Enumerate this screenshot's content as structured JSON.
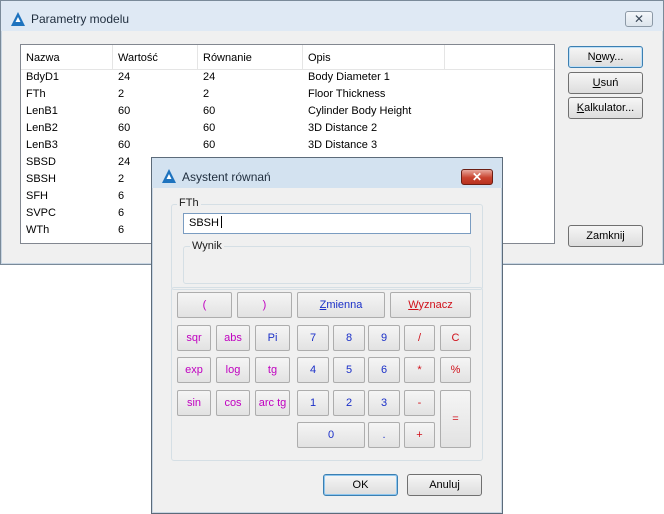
{
  "main_window": {
    "title": "Parametry modelu",
    "close_label": "✕",
    "columns": [
      "Nazwa",
      "Wartość",
      "Równanie",
      "Opis"
    ],
    "rows": [
      {
        "name": "BdyD1",
        "value": "24",
        "equation": "24",
        "description": "Body Diameter 1"
      },
      {
        "name": "FTh",
        "value": "2",
        "equation": "2",
        "description": "Floor Thickness"
      },
      {
        "name": "LenB1",
        "value": "60",
        "equation": "60",
        "description": "Cylinder Body Height"
      },
      {
        "name": "LenB2",
        "value": "60",
        "equation": "60",
        "description": "3D Distance 2"
      },
      {
        "name": "LenB3",
        "value": "60",
        "equation": "60",
        "description": "3D Distance 3"
      },
      {
        "name": "SBSD",
        "value": "24",
        "equation": "",
        "description": ""
      },
      {
        "name": "SBSH",
        "value": "2",
        "equation": "",
        "description": ""
      },
      {
        "name": "SFH",
        "value": "6",
        "equation": "",
        "description": ""
      },
      {
        "name": "SVPC",
        "value": "6",
        "equation": "",
        "description": ""
      },
      {
        "name": "WTh",
        "value": "6",
        "equation": "",
        "description": ""
      }
    ],
    "buttons": {
      "new": {
        "pre": "N",
        "ul": "o",
        "post": "wy..."
      },
      "delete": {
        "pre": "",
        "ul": "U",
        "post": "suń"
      },
      "calculator": {
        "pre": "",
        "ul": "K",
        "post": "alkulator..."
      },
      "close": {
        "pre": "Zamknij",
        "ul": "",
        "post": ""
      }
    }
  },
  "dialog": {
    "title": "Asystent równań",
    "close_label": "✕",
    "group_label": "FTh",
    "input_value": "SBSH",
    "result_label": "Wynik",
    "row1": {
      "open_paren": "(",
      "close_paren": ")",
      "variable": {
        "pre": "",
        "ul": "Z",
        "post": "mienna"
      },
      "calculate": {
        "pre": "",
        "ul": "W",
        "post": "yznacz"
      }
    },
    "functions": [
      "sqr",
      "abs",
      "Pi",
      "exp",
      "log",
      "tg",
      "sin",
      "cos",
      "arc tg"
    ],
    "digits": [
      "7",
      "8",
      "9",
      "4",
      "5",
      "6",
      "1",
      "2",
      "3",
      "0",
      "."
    ],
    "operators": [
      "/",
      "C",
      "*",
      "%",
      "-",
      "+",
      "="
    ],
    "ok_label": "OK",
    "cancel_label": "Anuluj"
  },
  "colors": {
    "function_keys": "#c000c0",
    "digit_keys": "#1a2fc8",
    "operator_keys": "#d0101a",
    "close_button_active": "#c9432f"
  }
}
